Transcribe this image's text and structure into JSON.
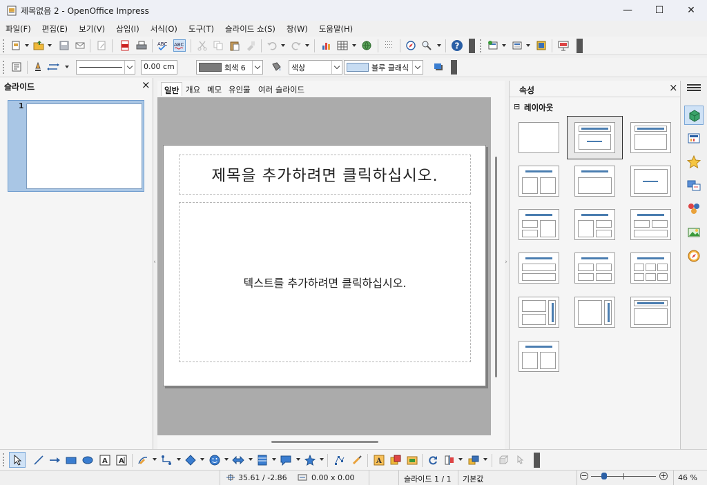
{
  "window": {
    "title": "제목없음 2 - OpenOffice Impress",
    "minimize_label": "—",
    "maximize_label": "☐",
    "close_label": "✕"
  },
  "menu": [
    "파일(F)",
    "편집(E)",
    "보기(V)",
    "삽입(I)",
    "서식(O)",
    "도구(T)",
    "슬라이드 쇼(S)",
    "창(W)",
    "도움말(H)"
  ],
  "line_toolbar": {
    "line_width_value": "0.00 cm",
    "line_color_value": "회색 6",
    "area_style_value": "색상",
    "area_color_value": "블루 클래식"
  },
  "slides_panel": {
    "title": "슬라이드",
    "close_label": "×",
    "slide_number": "1"
  },
  "view_tabs": [
    "일반",
    "개요",
    "메모",
    "유인물",
    "여러 슬라이드"
  ],
  "slide": {
    "title_placeholder": "제목을 추가하려면 클릭하십시오.",
    "text_placeholder": "텍스트를 추가하려면 클릭하십시오."
  },
  "properties_panel": {
    "title": "속성",
    "close_label": "×",
    "section_title": "레이아웃",
    "section_toggle": "⊟"
  },
  "statusbar": {
    "position": "35.61 / -2.86",
    "size": "0.00 x 0.00",
    "slide_info": "슬라이드 1 / 1",
    "master": "기본값",
    "zoom": "46 %"
  },
  "colors": {
    "accent": "#4a7db0",
    "workspace": "#ababab",
    "selection": "#a9c6e5"
  }
}
